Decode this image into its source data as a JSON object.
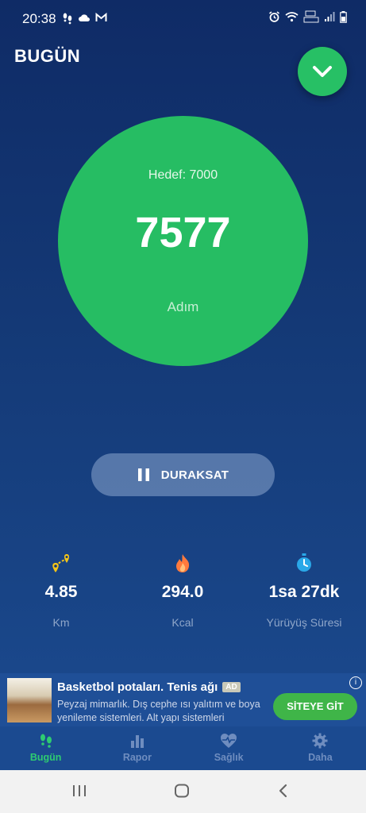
{
  "status_bar": {
    "time": "20:38"
  },
  "header": {
    "title": "BUGÜN"
  },
  "goal": {
    "label": "Hedef: 7000",
    "steps": "7577",
    "unit": "Adım"
  },
  "controls": {
    "pause_label": "DURAKSAT"
  },
  "stats": [
    {
      "value": "4.85",
      "unit": "Km",
      "icon": "route-pin-icon"
    },
    {
      "value": "294.0",
      "unit": "Kcal",
      "icon": "flame-icon"
    },
    {
      "value": "1sa 27dk",
      "unit": "Yürüyüş Süresi",
      "icon": "stopwatch-icon"
    }
  ],
  "ad": {
    "title": "Basketbol potaları. Tenis ağı",
    "badge": "AD",
    "description": "Peyzaj mimarlık. Dış cephe ısı yalıtım ve boya yenileme sistemleri. Alt yapı sistemleri",
    "cta": "SİTEYE GİT"
  },
  "nav": [
    {
      "label": "Bugün",
      "icon": "footsteps-icon",
      "active": true
    },
    {
      "label": "Rapor",
      "icon": "bar-chart-icon",
      "active": false
    },
    {
      "label": "Sağlık",
      "icon": "heart-pulse-icon",
      "active": false
    },
    {
      "label": "Daha",
      "icon": "gear-icon",
      "active": false
    }
  ],
  "colors": {
    "accent": "#26bd63",
    "background_top": "#0f2b66",
    "background_bottom": "#1c4d93",
    "cta": "#3fb548"
  }
}
